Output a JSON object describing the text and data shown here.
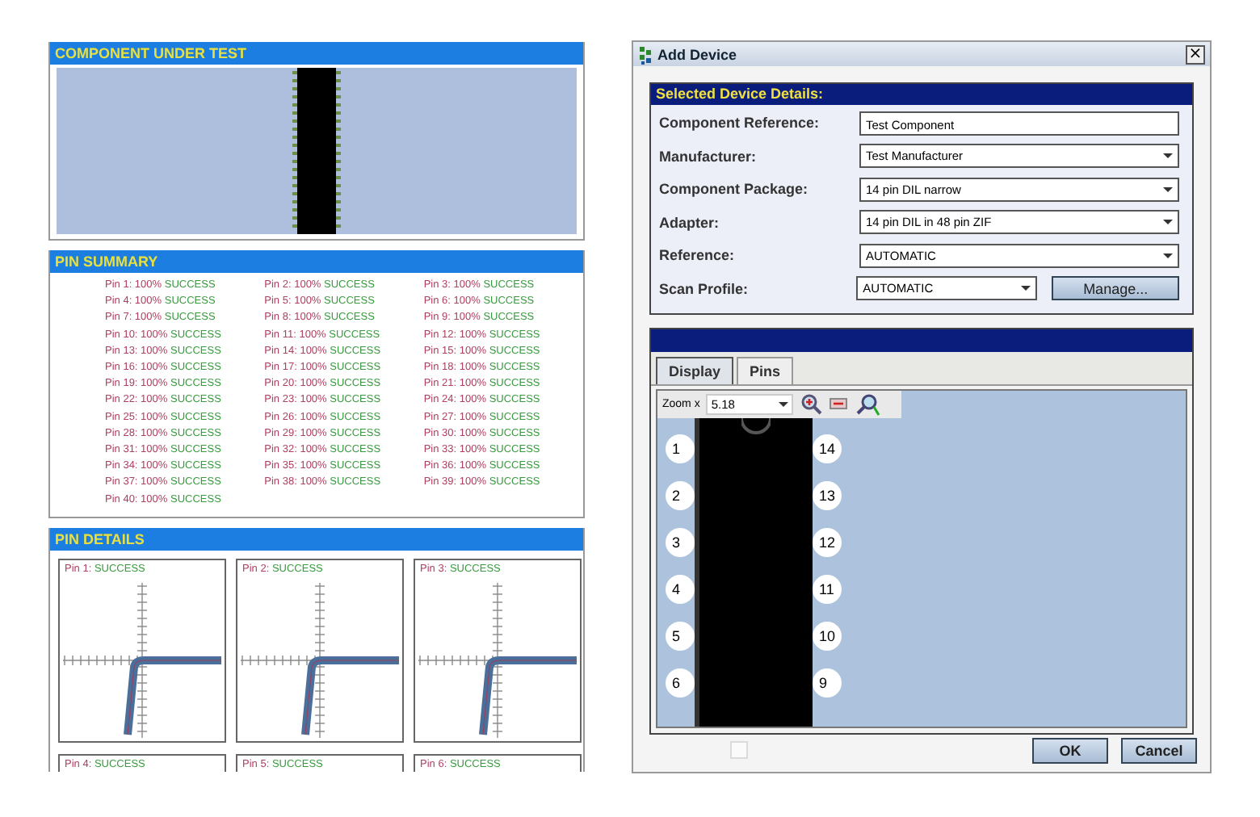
{
  "report": {
    "component_under_test": {
      "title": "COMPONENT UNDER TEST"
    },
    "pin_summary": {
      "title": "PIN SUMMARY",
      "items": [
        {
          "label": "Pin 1:",
          "percent": "100%",
          "result": "SUCCESS"
        },
        {
          "label": "Pin 2:",
          "percent": "100%",
          "result": "SUCCESS"
        },
        {
          "label": "Pin 3:",
          "percent": "100%",
          "result": "SUCCESS"
        },
        {
          "label": "Pin 4:",
          "percent": "100%",
          "result": "SUCCESS"
        },
        {
          "label": "Pin 5:",
          "percent": "100%",
          "result": "SUCCESS"
        },
        {
          "label": "Pin 6:",
          "percent": "100%",
          "result": "SUCCESS"
        },
        {
          "label": "Pin 7:",
          "percent": "100%",
          "result": "SUCCESS"
        },
        {
          "label": "Pin 8:",
          "percent": "100%",
          "result": "SUCCESS"
        },
        {
          "label": "Pin 9:",
          "percent": "100%",
          "result": "SUCCESS"
        },
        {
          "label": "Pin 10:",
          "percent": "100%",
          "result": "SUCCESS"
        },
        {
          "label": "Pin 11:",
          "percent": "100%",
          "result": "SUCCESS"
        },
        {
          "label": "Pin 12:",
          "percent": "100%",
          "result": "SUCCESS"
        },
        {
          "label": "Pin 13:",
          "percent": "100%",
          "result": "SUCCESS"
        },
        {
          "label": "Pin 14:",
          "percent": "100%",
          "result": "SUCCESS"
        },
        {
          "label": "Pin 15:",
          "percent": "100%",
          "result": "SUCCESS"
        },
        {
          "label": "Pin 16:",
          "percent": "100%",
          "result": "SUCCESS"
        },
        {
          "label": "Pin 17:",
          "percent": "100%",
          "result": "SUCCESS"
        },
        {
          "label": "Pin 18:",
          "percent": "100%",
          "result": "SUCCESS"
        },
        {
          "label": "Pin 19:",
          "percent": "100%",
          "result": "SUCCESS"
        },
        {
          "label": "Pin 20:",
          "percent": "100%",
          "result": "SUCCESS"
        },
        {
          "label": "Pin 21:",
          "percent": "100%",
          "result": "SUCCESS"
        },
        {
          "label": "Pin 22:",
          "percent": "100%",
          "result": "SUCCESS"
        },
        {
          "label": "Pin 23:",
          "percent": "100%",
          "result": "SUCCESS"
        },
        {
          "label": "Pin 24:",
          "percent": "100%",
          "result": "SUCCESS"
        },
        {
          "label": "Pin 25:",
          "percent": "100%",
          "result": "SUCCESS"
        },
        {
          "label": "Pin 26:",
          "percent": "100%",
          "result": "SUCCESS"
        },
        {
          "label": "Pin 27:",
          "percent": "100%",
          "result": "SUCCESS"
        },
        {
          "label": "Pin 28:",
          "percent": "100%",
          "result": "SUCCESS"
        },
        {
          "label": "Pin 29:",
          "percent": "100%",
          "result": "SUCCESS"
        },
        {
          "label": "Pin 30:",
          "percent": "100%",
          "result": "SUCCESS"
        },
        {
          "label": "Pin 31:",
          "percent": "100%",
          "result": "SUCCESS"
        },
        {
          "label": "Pin 32:",
          "percent": "100%",
          "result": "SUCCESS"
        },
        {
          "label": "Pin 33:",
          "percent": "100%",
          "result": "SUCCESS"
        },
        {
          "label": "Pin 34:",
          "percent": "100%",
          "result": "SUCCESS"
        },
        {
          "label": "Pin 35:",
          "percent": "100%",
          "result": "SUCCESS"
        },
        {
          "label": "Pin 36:",
          "percent": "100%",
          "result": "SUCCESS"
        },
        {
          "label": "Pin 37:",
          "percent": "100%",
          "result": "SUCCESS"
        },
        {
          "label": "Pin 38:",
          "percent": "100%",
          "result": "SUCCESS"
        },
        {
          "label": "Pin 39:",
          "percent": "100%",
          "result": "SUCCESS"
        },
        {
          "label": "Pin 40:",
          "percent": "100%",
          "result": "SUCCESS"
        }
      ]
    },
    "pin_details": {
      "title": "PIN DETAILS",
      "charts": [
        {
          "label": "Pin 1:",
          "result": "SUCCESS"
        },
        {
          "label": "Pin 2:",
          "result": "SUCCESS"
        },
        {
          "label": "Pin 3:",
          "result": "SUCCESS"
        },
        {
          "label": "Pin 4:",
          "result": "SUCCESS"
        },
        {
          "label": "Pin 5:",
          "result": "SUCCESS"
        },
        {
          "label": "Pin 6:",
          "result": "SUCCESS"
        }
      ]
    }
  },
  "dialog": {
    "title": "Add Device",
    "close": "×",
    "details": {
      "title": "Selected Device Details:",
      "fields": [
        {
          "kind": "text",
          "label": "Component Reference:",
          "value": "Test Component"
        },
        {
          "kind": "dropdown",
          "label": "Manufacturer:",
          "value": "Test Manufacturer"
        },
        {
          "kind": "dropdown",
          "label": "Component Package:",
          "value": "14 pin DIL narrow"
        },
        {
          "kind": "dropdown",
          "label": "Adapter:",
          "value": "14 pin DIL in 48 pin ZIF"
        },
        {
          "kind": "dropdown",
          "label": "Reference:",
          "value": "AUTOMATIC"
        },
        {
          "kind": "dropdown_button",
          "label": "Scan Profile:",
          "value": "AUTOMATIC",
          "button": "Manage..."
        }
      ]
    },
    "tabs": [
      {
        "label": "Display",
        "selected": true
      },
      {
        "label": "Pins",
        "selected": false
      }
    ],
    "zoom": {
      "label": "Zoom x",
      "value": "5.18"
    },
    "chip": {
      "left_pins": [
        "1",
        "2",
        "3",
        "4",
        "5",
        "6"
      ],
      "right_pins": [
        "14",
        "13",
        "12",
        "11",
        "10",
        "9"
      ]
    },
    "option_checkbox": {
      "checked": false,
      "disabled": true
    },
    "buttons": [
      "OK",
      "Cancel"
    ]
  }
}
